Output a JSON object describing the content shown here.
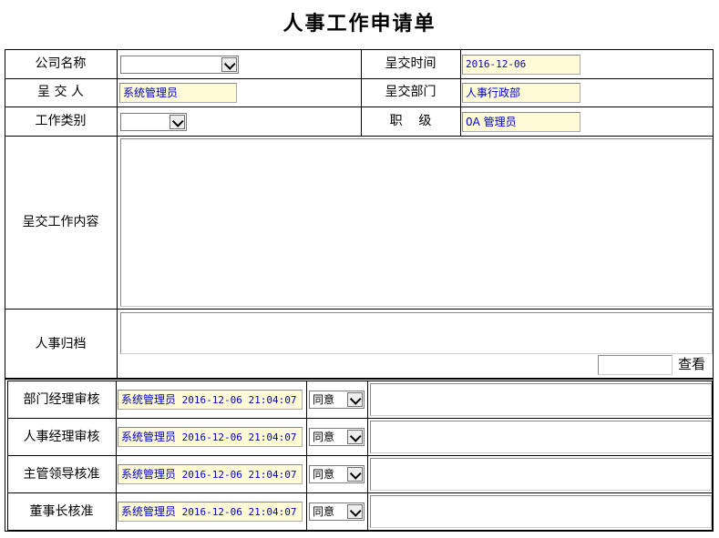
{
  "page": {
    "title": "人事工作申请单"
  },
  "form": {
    "company_label": "公司名称",
    "submit_time_label": "呈交时间",
    "submit_time_value": "2016-12-06",
    "submitter_label": "呈 交 人",
    "submitter_value": "系统管理员",
    "submit_dept_label": "呈交部门",
    "submit_dept_value": "人事行政部",
    "work_type_label": "工作类别",
    "position_label": "职    级",
    "position_value": "0A 管理员",
    "content_label": "呈交工作内容",
    "archive_label": "人事归档",
    "view_button": "查看"
  },
  "approvals": [
    {
      "label": "部门经理审核",
      "approver": "系统管理员",
      "time": "2016-12-06 21:04:07",
      "decision": "同意"
    },
    {
      "label": "人事经理审核",
      "approver": "系统管理员",
      "time": "2016-12-06 21:04:07",
      "decision": "同意"
    },
    {
      "label": "主管领导核准",
      "approver": "系统管理员",
      "time": "2016-12-06 21:04:07",
      "decision": "同意"
    },
    {
      "label": "董事长核准",
      "approver": "系统管理员",
      "time": "2016-12-06 21:04:07",
      "decision": "同意"
    }
  ]
}
